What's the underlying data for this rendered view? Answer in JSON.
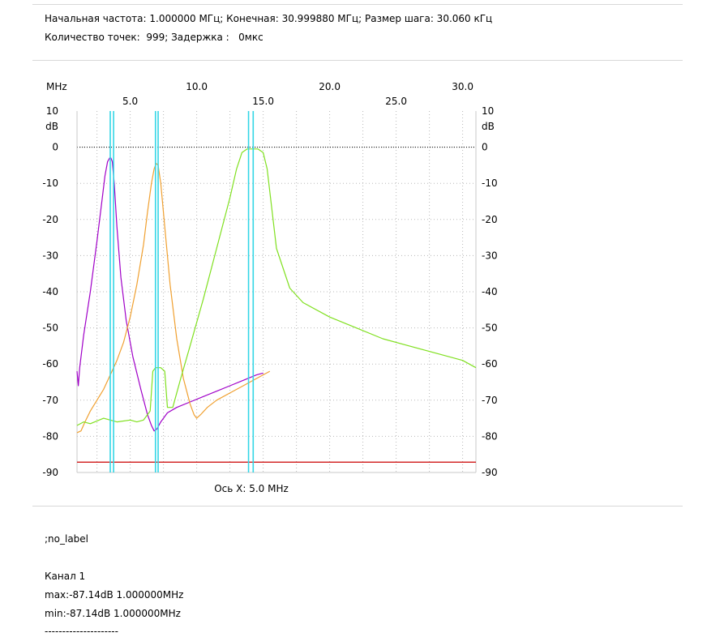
{
  "header": {
    "line1": "Начальная частота: 1.000000 МГц; Конечная: 30.999880 МГц; Размер шага: 30.060 кГц",
    "line2": "Количество точек:  999; Задержка :   0мкс"
  },
  "footer": {
    "label": ";no_label",
    "channel": "Канал 1",
    "max": "max:-87.14dB 1.000000MHz",
    "min": "min:-87.14dB 1.000000MHz",
    "separator": "---------------------"
  },
  "chart_data": {
    "type": "line",
    "x_unit_label": "MHz",
    "y_unit_label": "dB",
    "xlabel": "Ось X: 5.0 MHz",
    "xlim": [
      1.0,
      31.0
    ],
    "ylim": [
      -90,
      10
    ],
    "x_ticks_upper": [
      10.0,
      20.0,
      30.0
    ],
    "x_ticks_lower": [
      5.0,
      15.0,
      25.0
    ],
    "x_tick_labels_upper": [
      "10.0",
      "20.0",
      "30.0"
    ],
    "x_tick_labels_lower": [
      "5.0",
      "15.0",
      "25.0"
    ],
    "y_ticks": [
      10,
      0,
      -10,
      -20,
      -30,
      -40,
      -50,
      -60,
      -70,
      -80,
      -90
    ],
    "y_tick_labels": [
      "10",
      "0",
      "-10",
      "-20",
      "-30",
      "-40",
      "-50",
      "-60",
      "-70",
      "-80",
      "-90"
    ],
    "grid": true,
    "reference_line": {
      "y": 0,
      "color": "#000000",
      "style": "dotted"
    },
    "floor_line": {
      "y": -87.14,
      "color": "#cc0000"
    },
    "markers": {
      "color": "#33d6e6",
      "x": [
        3.5,
        3.75,
        6.9,
        7.1,
        13.9,
        14.25
      ]
    },
    "series": [
      {
        "color": "#a000c8",
        "x": [
          1.0,
          1.1,
          1.2,
          1.5,
          2.0,
          2.5,
          2.9,
          3.1,
          3.3,
          3.45,
          3.55,
          3.65,
          3.8,
          4.0,
          4.3,
          4.7,
          5.2,
          5.8,
          6.3,
          6.6,
          6.8,
          7.0,
          7.3,
          7.8,
          8.5,
          9.5,
          10.5,
          11.5,
          12.5,
          13.5,
          14.5,
          15.0
        ],
        "y": [
          -62,
          -66,
          -61,
          -52,
          -40,
          -26,
          -14,
          -8,
          -4,
          -3,
          -3,
          -4,
          -10,
          -22,
          -36,
          -48,
          -58,
          -67,
          -74,
          -77,
          -78.5,
          -78,
          -76,
          -73.5,
          -72,
          -70.5,
          -69,
          -67.5,
          -66,
          -64.5,
          -63,
          -62.5
        ]
      },
      {
        "color": "#f0a030",
        "x": [
          1.0,
          1.3,
          1.6,
          2.0,
          2.5,
          3.0,
          3.5,
          4.0,
          4.5,
          5.0,
          5.5,
          6.0,
          6.3,
          6.6,
          6.8,
          6.95,
          7.1,
          7.3,
          7.6,
          8.0,
          8.5,
          9.0,
          9.5,
          9.8,
          10.0,
          10.3,
          10.8,
          11.5,
          12.5,
          13.5,
          14.5,
          15.5
        ],
        "y": [
          -79,
          -78.5,
          -76,
          -73,
          -70,
          -67,
          -63,
          -59,
          -54,
          -47,
          -38,
          -27,
          -18,
          -10,
          -6,
          -4.5,
          -5,
          -10,
          -22,
          -38,
          -53,
          -64,
          -71,
          -74,
          -75,
          -74,
          -72,
          -70,
          -68,
          -66,
          -64,
          -62
        ]
      },
      {
        "color": "#80e020",
        "x": [
          1.0,
          1.5,
          2.0,
          3.0,
          4.0,
          5.0,
          5.5,
          6.0,
          6.5,
          6.7,
          6.9,
          7.3,
          7.6,
          7.8,
          8.2,
          8.8,
          9.5,
          10.5,
          11.5,
          12.5,
          13.0,
          13.4,
          13.8,
          14.2,
          14.6,
          15.0,
          15.3,
          16.0,
          17.0,
          18.0,
          20.0,
          22.0,
          24.0,
          26.0,
          28.0,
          30.0,
          31.0
        ],
        "y": [
          -77,
          -76,
          -76.5,
          -75,
          -76,
          -75.5,
          -76,
          -75.5,
          -73,
          -62,
          -61,
          -61,
          -62,
          -72,
          -72,
          -64,
          -55,
          -42,
          -28,
          -14,
          -6,
          -1.5,
          -0.5,
          -0.5,
          -0.5,
          -1.5,
          -6,
          -28,
          -39,
          -43,
          -47,
          -50,
          -53,
          -55,
          -57,
          -59,
          -61
        ]
      }
    ]
  }
}
